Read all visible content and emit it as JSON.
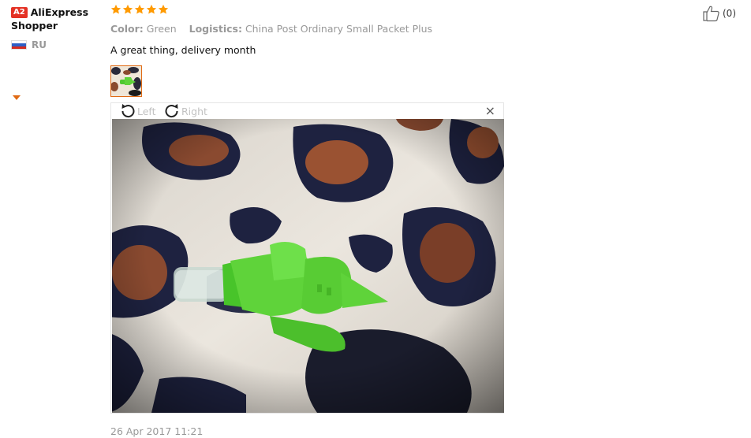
{
  "user": {
    "level_badge": "A2",
    "name": "AliExpress Shopper",
    "country_code": "RU"
  },
  "review": {
    "rating": 5,
    "color_label": "Color:",
    "color_value": "Green",
    "logistics_label": "Logistics:",
    "logistics_value": "China Post Ordinary Small Packet Plus",
    "text": "A great thing, delivery month",
    "date": "26 Apr 2017 11:21"
  },
  "viewer": {
    "rotate_left_label": "Left",
    "rotate_right_label": "Right",
    "close_glyph": "×"
  },
  "helpful": {
    "count_text": "(0)"
  },
  "colors": {
    "star": "#ff9a00",
    "badge": "#e43225",
    "accent_border": "#e06a14",
    "product_green": "#5fd33a"
  }
}
